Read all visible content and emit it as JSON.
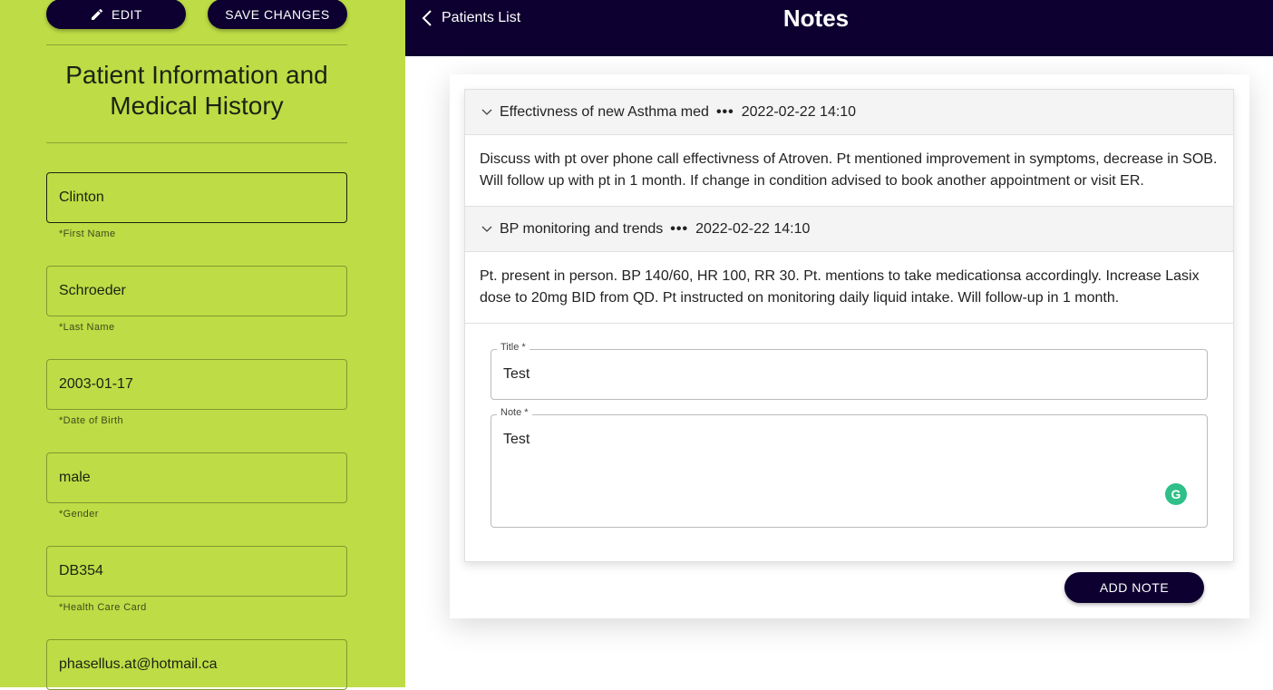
{
  "left": {
    "edit_label": "EDIT",
    "save_label": "SAVE CHANGES",
    "title": "Patient Information and Medical History",
    "fields": [
      {
        "value": "Clinton",
        "label": "*First Name"
      },
      {
        "value": "Schroeder",
        "label": "*Last Name"
      },
      {
        "value": "2003-01-17",
        "label": "*Date of Birth"
      },
      {
        "value": "male",
        "label": "*Gender"
      },
      {
        "value": "DB354",
        "label": "*Health Care Card"
      },
      {
        "value": "phasellus.at@hotmail.ca",
        "label": ""
      }
    ]
  },
  "header": {
    "back_label": "Patients List",
    "title": "Notes"
  },
  "notes": [
    {
      "title": "Effectivness of new Asthma med",
      "separator": "•••",
      "timestamp": "2022-02-22 14:10",
      "body": "Discuss with pt over phone call effectivness of Atroven. Pt mentioned improvement in symptoms, decrease in SOB. Will follow up with pt in 1 month. If change in condition advised to book another appointment or visit ER."
    },
    {
      "title": "BP monitoring and trends",
      "separator": "•••",
      "timestamp": "2022-02-22 14:10",
      "body": "Pt. present in person. BP 140/60, HR 100, RR 30. Pt. mentions to take medicationsa accordingly. Increase Lasix dose to 20mg BID from QD. Pt instructed on monitoring daily liquid intake. Will follow-up in 1 month."
    }
  ],
  "form": {
    "title_label": "Title *",
    "title_value": "Test",
    "note_label": "Note *",
    "note_value": "Test",
    "add_label": "ADD NOTE"
  },
  "colors": {
    "sidebar": "#bedc45",
    "primary": "#0d0030",
    "grammarly": "#2fbf88"
  }
}
